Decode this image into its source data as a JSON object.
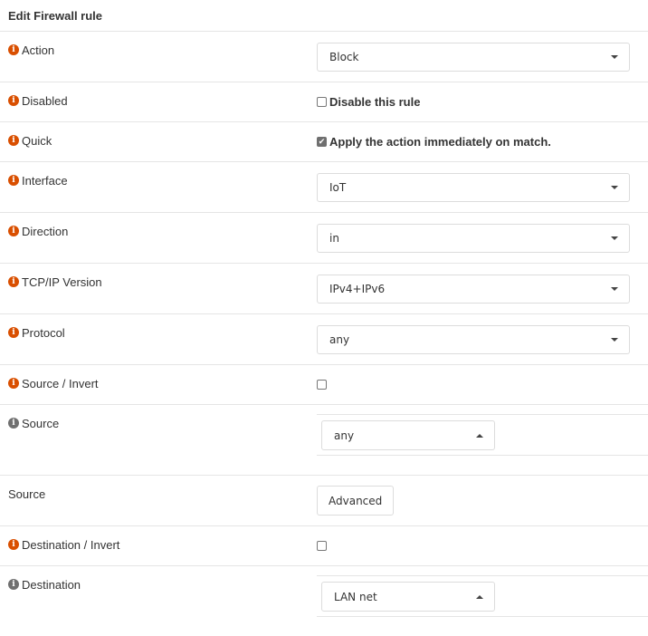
{
  "header": {
    "title": "Edit Firewall rule"
  },
  "rows": {
    "action": {
      "label": "Action",
      "value": "Block"
    },
    "disabled": {
      "label": "Disabled",
      "checkbox_label": "Disable this rule",
      "checked": false
    },
    "quick": {
      "label": "Quick",
      "checkbox_label": "Apply the action immediately on match.",
      "checked": true
    },
    "interface": {
      "label": "Interface",
      "value": "IoT"
    },
    "direction": {
      "label": "Direction",
      "value": "in"
    },
    "ipversion": {
      "label": "TCP/IP Version",
      "value": "IPv4+IPv6"
    },
    "protocol": {
      "label": "Protocol",
      "value": "any"
    },
    "source_invert": {
      "label": "Source / Invert",
      "checked": false
    },
    "source": {
      "label": "Source",
      "value": "any"
    },
    "source_advanced": {
      "label": "Source",
      "button_label": "Advanced"
    },
    "destination_invert": {
      "label": "Destination / Invert",
      "checked": false
    },
    "destination": {
      "label": "Destination",
      "value": "LAN net"
    }
  },
  "icons": {
    "info": "info-circle-icon",
    "select_caret": "caret-down-icon",
    "select_caret_open": "caret-up-icon",
    "check": "checkmark-icon"
  },
  "colors": {
    "info_required": "#d94f00",
    "info_optional": "#6f6f6f",
    "border": "#e5e5e5",
    "checkbox_checked": "#6f6f6f"
  }
}
